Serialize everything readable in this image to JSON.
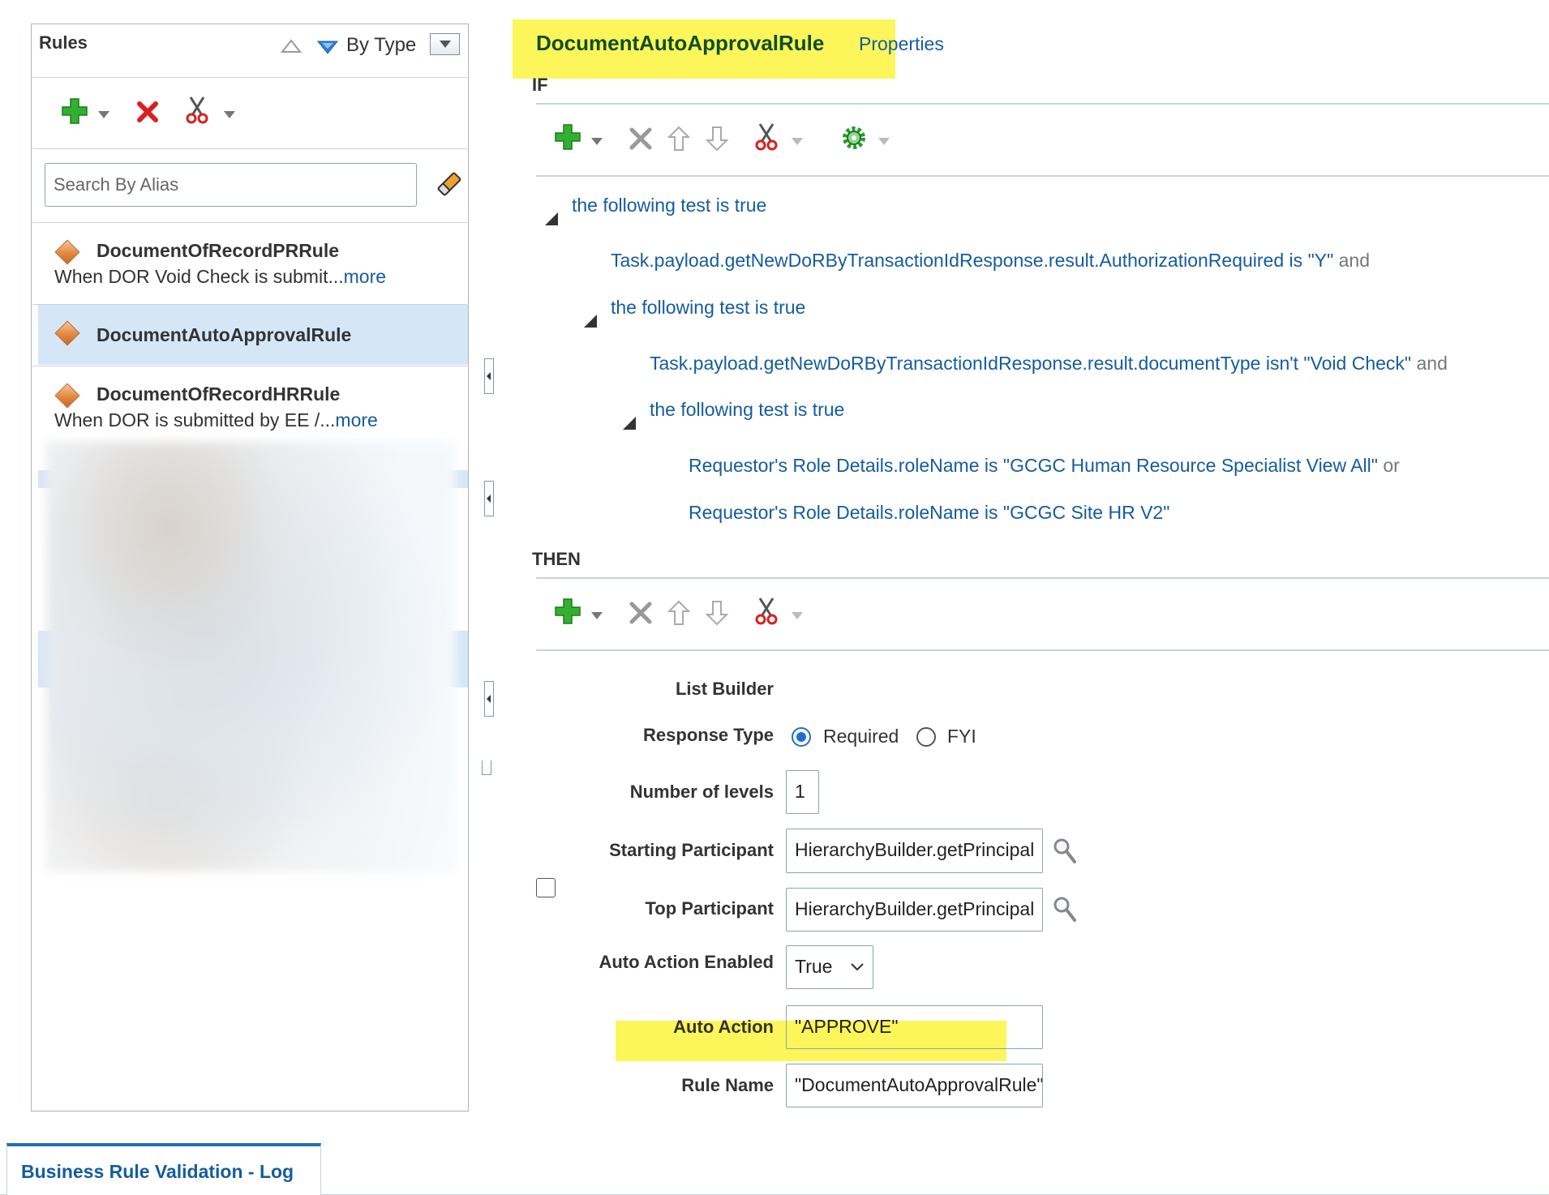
{
  "rules_panel": {
    "title": "Rules",
    "sort_label": "By Type",
    "search_placeholder": "Search By Alias",
    "items": [
      {
        "name": "DocumentOfRecordPRRule",
        "desc": "When DOR Void Check is submit...",
        "more": "more",
        "selected": false
      },
      {
        "name": "DocumentAutoApprovalRule",
        "desc": "",
        "more": "",
        "selected": true
      },
      {
        "name": "DocumentOfRecordHRRule",
        "desc": "When DOR is submitted by EE /...",
        "more": "more",
        "selected": false
      }
    ]
  },
  "rule": {
    "title": "DocumentAutoApprovalRule",
    "properties_link": "Properties",
    "if_label": "IF",
    "then_label": "THEN",
    "conditions": {
      "test_true": "the following test is true",
      "c1_field": "Task.payload.getNewDoRByTransactionIdResponse.result.AuthorizationRequired",
      "c1_op": "is",
      "c1_value": "\"Y\"",
      "c1_join": "and",
      "c2_field": "Task.payload.getNewDoRByTransactionIdResponse.result.documentType",
      "c2_op": "isn't",
      "c2_value": "\"Void Check\"",
      "c2_join": "and",
      "c3_field": "Requestor's Role Details.roleName",
      "c3_op": "is",
      "c3_value": "\"GCGC Human Resource Specialist View All\"",
      "c3_join": "or",
      "c4_field": "Requestor's Role Details.roleName",
      "c4_op": "is",
      "c4_value": "\"GCGC Site HR V2\""
    },
    "action": {
      "list_builder_label": "List Builder",
      "response_type_label": "Response Type",
      "response_options": [
        "Required",
        "FYI"
      ],
      "response_selected": "Required",
      "levels_label": "Number of levels",
      "levels_value": "1",
      "starting_participant_label": "Starting Participant",
      "starting_participant_value": "HierarchyBuilder.getPrincipal",
      "top_participant_label": "Top Participant",
      "top_participant_value": "HierarchyBuilder.getPrincipal",
      "auto_action_enabled_label": "Auto Action Enabled",
      "auto_action_enabled_value": "True",
      "auto_action_label": "Auto Action",
      "auto_action_value": "\"APPROVE\"",
      "rule_name_label": "Rule Name",
      "rule_name_value": "\"DocumentAutoApprovalRule\""
    }
  },
  "bottom_tab": {
    "label": "Business Rule Validation - Log"
  },
  "colors": {
    "highlight": "#fcf65a",
    "link": "#145c9e",
    "selected_row": "#d5e7f7",
    "add_green": "#2fa52f",
    "delete_red": "#d92020"
  }
}
